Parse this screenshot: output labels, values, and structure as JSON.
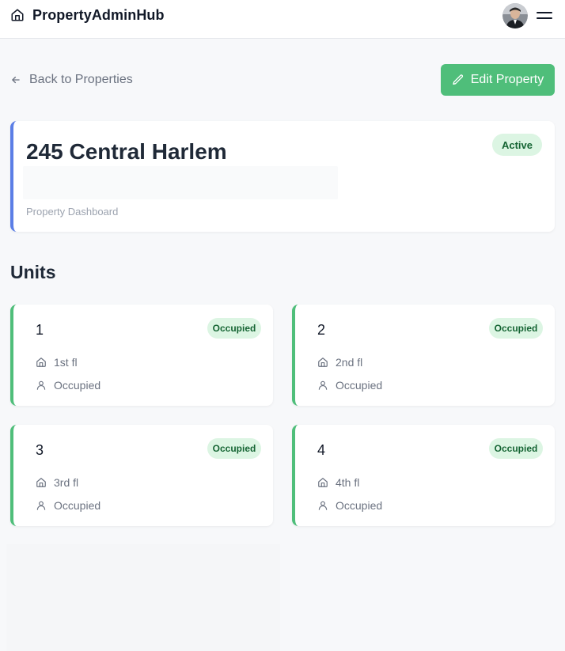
{
  "app": {
    "name": "PropertyAdminHub",
    "brand_icon": "home-icon",
    "menu_icon": "hamburger-menu-icon"
  },
  "nav": {
    "back_label": "Back to Properties",
    "edit_label": "Edit Property"
  },
  "property": {
    "title": "245 Central Harlem",
    "subtitle": "Property Dashboard",
    "status": "Active"
  },
  "units": {
    "heading": "Units",
    "items": [
      {
        "number": "1",
        "status": "Occupied",
        "floor": "1st fl",
        "occupancy": "Occupied"
      },
      {
        "number": "2",
        "status": "Occupied",
        "floor": "2nd fl",
        "occupancy": "Occupied"
      },
      {
        "number": "3",
        "status": "Occupied",
        "floor": "3rd fl",
        "occupancy": "Occupied"
      },
      {
        "number": "4",
        "status": "Occupied",
        "floor": "4th fl",
        "occupancy": "Occupied"
      }
    ]
  },
  "colors": {
    "accent_green": "#4fbe7a",
    "accent_blue": "#5b7ee6",
    "badge_bg": "#dcf5e3",
    "badge_text": "#166534"
  }
}
